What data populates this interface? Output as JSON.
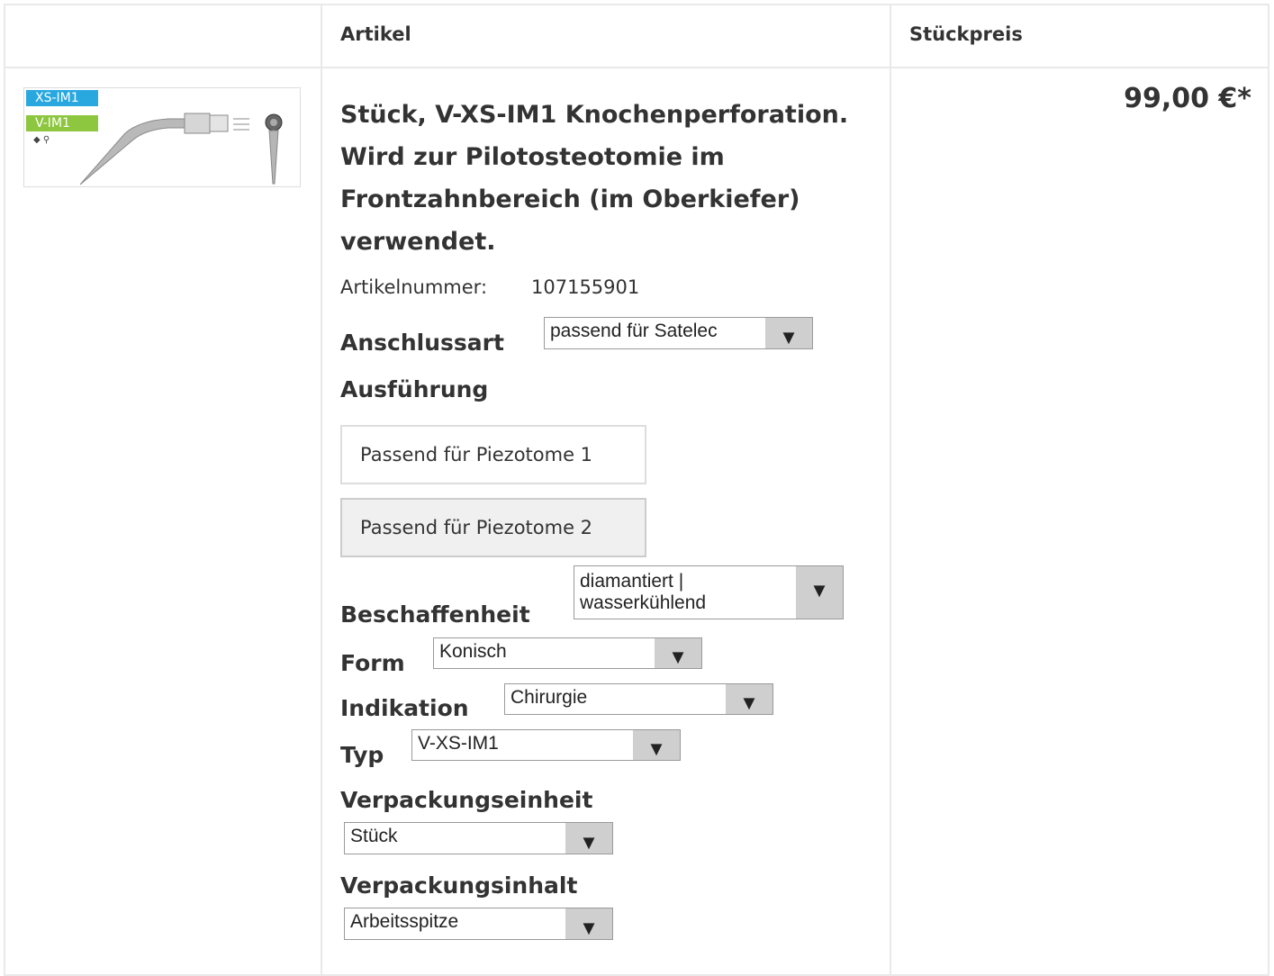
{
  "table": {
    "headers": {
      "article": "Artikel",
      "unit_price": "Stückpreis"
    }
  },
  "product": {
    "image_tags": [
      "XS-IM1",
      "V-IM1"
    ],
    "title": "Stück, V-XS-IM1 Knochenperforation. Wird zur Pilotosteotomie im Frontzahnbereich (im Oberkiefer) verwendet.",
    "article_number_label": "Artikelnummer:",
    "article_number": "107155901",
    "price": "99,00 €*"
  },
  "options": {
    "anschlussart": {
      "label": "Anschlussart",
      "value": "passend für Satelec"
    },
    "ausfuehrung": {
      "label": "Ausführung",
      "buttons": [
        "Passend für Piezotome 1",
        "Passend für Piezotome 2"
      ],
      "selected_index": 1
    },
    "beschaffenheit": {
      "label": "Beschaffenheit",
      "value_line1": "diamantiert |",
      "value_line2": "wasserkühlend"
    },
    "form": {
      "label": "Form",
      "value": "Konisch"
    },
    "indikation": {
      "label": "Indikation",
      "value": "Chirurgie"
    },
    "typ": {
      "label": "Typ",
      "value": "V-XS-IM1"
    },
    "verpackungseinheit": {
      "label": "Verpackungseinheit",
      "value": "Stück"
    },
    "verpackungsinhalt": {
      "label": "Verpackungsinhalt",
      "value": "Arbeitsspitze"
    }
  },
  "colors": {
    "tag_blue": "#29a8e0",
    "tag_green": "#8dc63f",
    "border": "#e9e9e9",
    "select_arrow_bg": "#cfcfcf"
  },
  "icons": {
    "dropdown": "▼"
  }
}
